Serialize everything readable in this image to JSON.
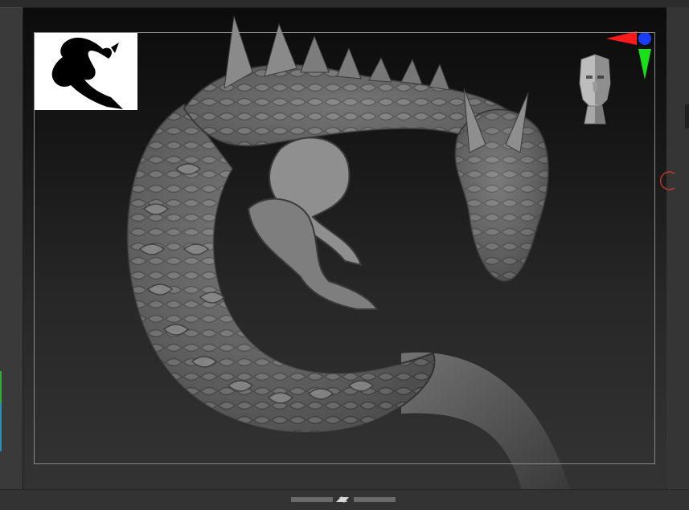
{
  "app": {
    "view": "canvas",
    "accent_colors": {
      "x_axis": "#ff1a1a",
      "y_axis": "#19e019",
      "z_axis": "#1a3cff",
      "rotate_indicator": "#c23a2a",
      "left_accent_top": "#2fae3c",
      "left_accent_bottom": "#2b8fb3"
    }
  },
  "canvas": {
    "model": "dragon-sculpt",
    "thumbnail": "dragon-silhouette",
    "navigator": "head-navigator",
    "gyro": "axis-gyro-icon"
  },
  "icons": [
    "axis-gyro-icon",
    "head-navigator-icon",
    "rotate-indicator-icon",
    "collapse-handle-icon"
  ]
}
